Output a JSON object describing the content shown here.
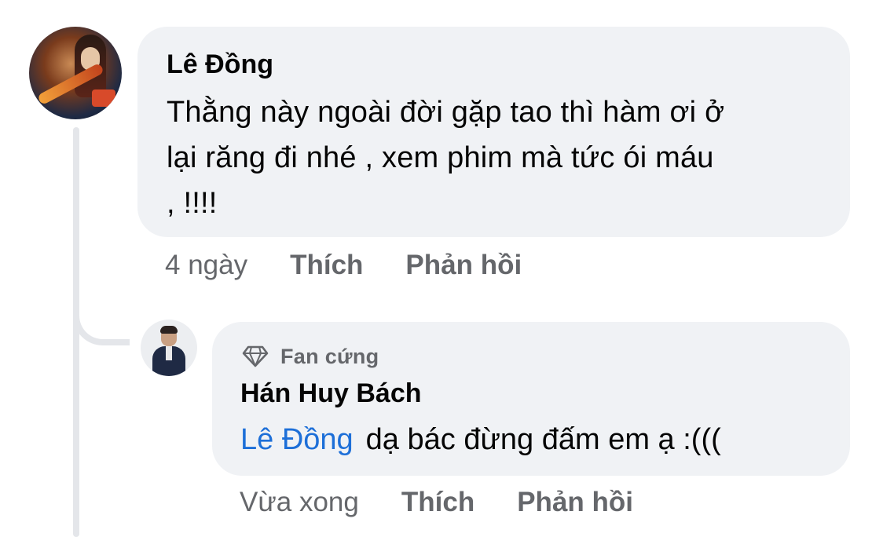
{
  "comment": {
    "author": "Lê Đồng",
    "text_lines": [
      "Thằng này ngoài đời gặp tao thì hàm ơi ở",
      "lại răng đi nhé , xem phim mà tức ói máu",
      ", !!!!"
    ],
    "time": "4 ngày",
    "like_label": "Thích",
    "reply_label": "Phản hồi",
    "avatar_icon": "game-character-avatar"
  },
  "reply": {
    "badge_icon": "diamond-icon",
    "badge_label": "Fan cứng",
    "author": "Hán Huy Bách",
    "mention": "Lê Đồng",
    "text": "dạ bác đừng đấm em ạ :(((",
    "time": "Vừa xong",
    "like_label": "Thích",
    "reply_label": "Phản hồi",
    "avatar_icon": "person-avatar"
  },
  "colors": {
    "bubble": "#f0f2f5",
    "text": "#050505",
    "secondary": "#65676b",
    "mention": "#1d6fd8",
    "thread_line": "#e4e6ea"
  }
}
